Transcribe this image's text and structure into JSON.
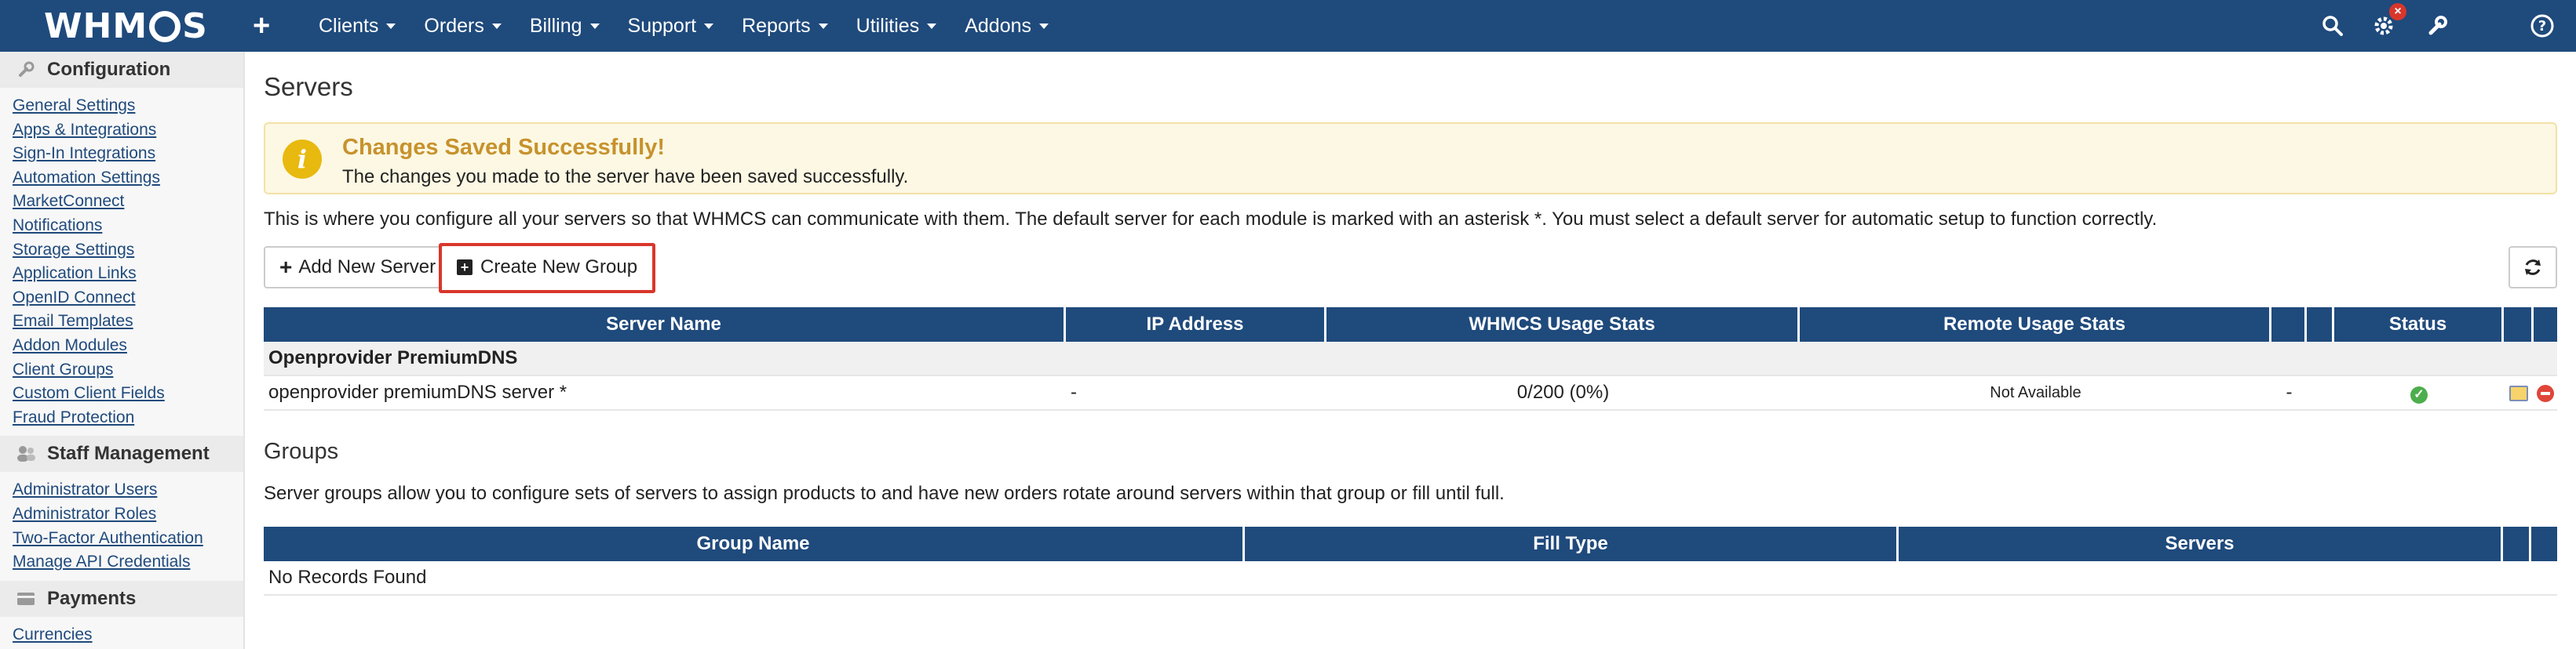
{
  "brand": {
    "logo_text_left": "WHM",
    "logo_text_right": "S"
  },
  "topnav": {
    "add_icon": "plus-icon",
    "items": [
      "Clients",
      "Orders",
      "Billing",
      "Support",
      "Reports",
      "Utilities",
      "Addons"
    ],
    "right_icons": [
      "search-icon",
      "gear-icon",
      "wrench-icon",
      "help-icon"
    ],
    "notification_badge": "×"
  },
  "sidebar": {
    "sections": [
      {
        "title": "Configuration",
        "icon": "wrench-icon",
        "links": [
          "General Settings",
          "Apps & Integrations",
          "Sign-In Integrations",
          "Automation Settings",
          "MarketConnect",
          "Notifications",
          "Storage Settings",
          "Application Links",
          "OpenID Connect",
          "Email Templates",
          "Addon Modules",
          "Client Groups",
          "Custom Client Fields",
          "Fraud Protection"
        ]
      },
      {
        "title": "Staff Management",
        "icon": "users-icon",
        "links": [
          "Administrator Users",
          "Administrator Roles",
          "Two-Factor Authentication",
          "Manage API Credentials"
        ]
      },
      {
        "title": "Payments",
        "icon": "credit-card-icon",
        "links": [
          "Currencies"
        ]
      }
    ]
  },
  "page": {
    "title": "Servers",
    "alert": {
      "title": "Changes Saved Successfully!",
      "text": "The changes you made to the server have been saved successfully.",
      "icon_glyph": "i"
    },
    "intro": "This is where you configure all your servers so that WHMCS can communicate with them. The default server for each module is marked with an asterisk *. You must select a default server for automatic setup to function correctly.",
    "buttons": {
      "add_server": "Add New Server",
      "create_group": "Create New Group"
    }
  },
  "servers_table": {
    "headers": [
      "Server Name",
      "IP Address",
      "WHMCS Usage Stats",
      "Remote Usage Stats",
      "",
      "",
      "Status",
      "",
      ""
    ],
    "group_name": "Openprovider PremiumDNS",
    "rows": [
      {
        "name": "openprovider premiumDNS server *",
        "ip": "-",
        "whmcs_usage": "0/200 (0%)",
        "remote_usage": "Not Available",
        "extra": "-",
        "status": "active"
      }
    ]
  },
  "groups": {
    "title": "Groups",
    "text": "Server groups allow you to configure sets of servers to assign products to and have new orders rotate around servers within that group or fill until full.",
    "headers": [
      "Group Name",
      "Fill Type",
      "Servers",
      "",
      ""
    ],
    "empty": "No Records Found"
  },
  "colors": {
    "nav": "#1f4a7c",
    "alert_bg": "#fcf8e3",
    "alert_title": "#c7922d",
    "highlight": "#d9362b"
  }
}
